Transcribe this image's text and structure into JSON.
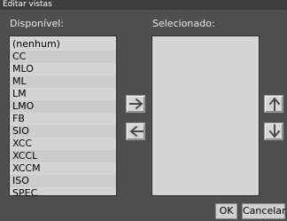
{
  "window": {
    "title": "Editar vistas"
  },
  "available": {
    "label": "Disponível:",
    "items": [
      "(nenhum)",
      "CC",
      "MLO",
      "ML",
      "LM",
      "LMO",
      "FB",
      "SIO",
      "XCC",
      "XCCL",
      "XCCM",
      "ISO",
      "SPEC"
    ]
  },
  "selected": {
    "label": "Selecionado:",
    "items": []
  },
  "buttons": {
    "add_icon": "arrow-right-icon",
    "remove_icon": "arrow-left-icon",
    "up_icon": "arrow-up-icon",
    "down_icon": "arrow-down-icon",
    "ok": "OK",
    "cancel": "Cancelar"
  },
  "colors": {
    "background": "#4f4f4f",
    "list_background": "#d4d4d4",
    "icon_color": "#4a4a4a"
  }
}
